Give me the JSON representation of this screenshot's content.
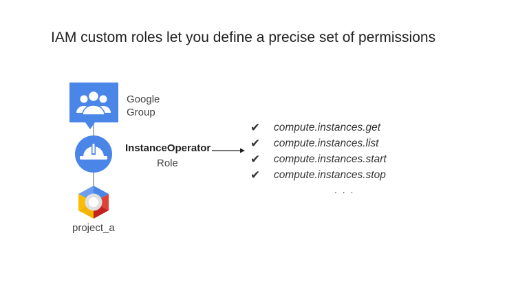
{
  "title": "IAM custom roles let you define a precise set of permissions",
  "group": {
    "line1": "Google",
    "line2": "Group",
    "icon": "group-icon"
  },
  "role": {
    "name": "InstanceOperator",
    "sub": "Role",
    "icon": "hardhat-icon"
  },
  "project": {
    "label": "project_a",
    "icon": "gcp-hexagon-icon"
  },
  "check_mark": "✔",
  "permissions": [
    "compute.instances.get",
    "compute.instances.list",
    "compute.instances.start",
    "compute.instances.stop"
  ],
  "ellipsis": ". . .",
  "colors": {
    "blue": "#4a86e8",
    "red": "#db4437",
    "yellow": "#f4b400",
    "green": "#0f9d58"
  }
}
